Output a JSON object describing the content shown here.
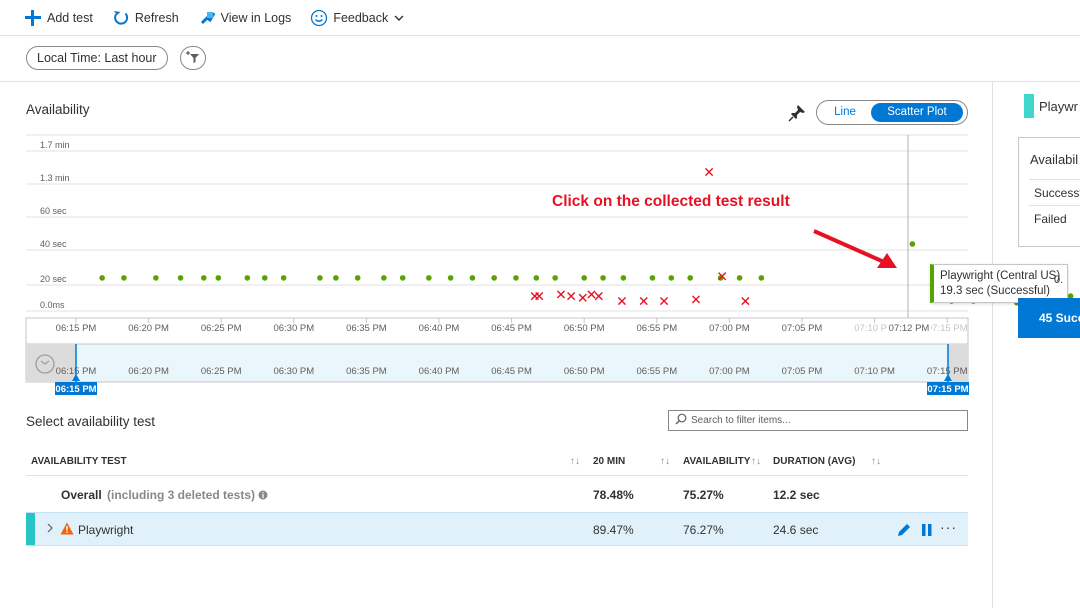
{
  "toolbar": {
    "add_test": "Add test",
    "refresh": "Refresh",
    "view_in_logs": "View in Logs",
    "feedback": "Feedback"
  },
  "filter": {
    "time_range": "Local Time: Last hour"
  },
  "chart_panel": {
    "title": "Availability",
    "toggle_line": "Line",
    "toggle_scatter": "Scatter Plot",
    "annotation": "Click on the collected test result"
  },
  "chart_data": {
    "type": "scatter",
    "title": "Availability",
    "xlabel": "",
    "ylabel": "",
    "x_ticks": [
      "06:15 PM",
      "06:20 PM",
      "06:25 PM",
      "06:30 PM",
      "06:35 PM",
      "06:40 PM",
      "06:45 PM",
      "06:50 PM",
      "06:55 PM",
      "07:00 PM",
      "07:05 PM",
      "07:10 PM",
      "07:15 PM"
    ],
    "y_ticks": [
      "0.0ms",
      "20 sec",
      "40 sec",
      "60 sec",
      "1.3 min",
      "1.7 min"
    ],
    "y_tick_values": [
      0,
      20,
      40,
      60,
      80,
      100
    ],
    "x_range_minutes": [
      0,
      60
    ],
    "ylim": [
      0,
      100
    ],
    "hover_time_label": "07:12 PM",
    "series": [
      {
        "name": "Successful",
        "color": "#57a300",
        "marker": "dot",
        "x": [
          1.8,
          3.3,
          5.5,
          7.2,
          8.8,
          9.8,
          11.8,
          13.0,
          14.3,
          16.8,
          17.9,
          19.4,
          21.2,
          22.5,
          24.3,
          25.8,
          27.3,
          28.8,
          30.3,
          31.7,
          33.0,
          35.0,
          36.3,
          37.7,
          39.7,
          41.0,
          42.3,
          44.4,
          45.7,
          47.2,
          57.6,
          59.1,
          60.3,
          61.8,
          63.5,
          64.8,
          66.1,
          67.2,
          68.5,
          70.0,
          71.3,
          72.6,
          74.0,
          75.2,
          76.4,
          78.5
        ],
        "y": [
          20,
          20,
          20,
          20,
          20,
          20,
          20,
          20,
          20,
          20,
          20,
          20,
          20,
          20,
          20,
          20,
          20,
          20,
          20,
          20,
          20,
          20,
          20,
          20,
          20,
          20,
          20,
          20,
          20,
          20,
          40.5,
          19.5,
          6,
          6,
          9,
          5,
          7,
          8,
          9,
          9,
          8,
          7,
          9,
          12,
          10,
          19.3
        ]
      },
      {
        "name": "Failed",
        "color": "#e81123",
        "marker": "x",
        "x": [
          31.6,
          31.9,
          33.4,
          34.1,
          34.9,
          35.5,
          36.0,
          37.6,
          39.1,
          40.5,
          42.7,
          43.6,
          44.5,
          46.1
        ],
        "y": [
          9,
          9,
          10,
          9,
          8,
          10,
          9,
          6,
          6,
          6,
          7,
          84,
          21,
          6
        ]
      }
    ],
    "range_selector": {
      "start_label": "06:15 PM",
      "end_label": "07:15 PM"
    }
  },
  "test_list": {
    "title": "Select availability test",
    "search_placeholder": "Search to filter items...",
    "columns": [
      "AVAILABILITY TEST",
      "20 MIN",
      "AVAILABILITY",
      "DURATION (AVG)"
    ],
    "overall": {
      "label": "Overall",
      "note": "(including 3 deleted tests)",
      "min20": "78.48%",
      "availability": "75.27%",
      "duration": "12.2 sec"
    },
    "rows": [
      {
        "name": "Playwright",
        "min20": "89.47%",
        "availability": "76.27%",
        "duration": "24.6 sec"
      }
    ]
  },
  "tooltip": {
    "line1": "Playwright (Central US)",
    "line2": "19.3 sec (Successful)"
  },
  "right_panel": {
    "title": "Playwr",
    "card_title": "Availabil",
    "row1": "Successf",
    "row2": "Failed",
    "obs": "0.",
    "blue_button": "45 Succ"
  },
  "colors": {
    "accent": "#0078d4",
    "success": "#57a300",
    "failure": "#e81123",
    "row_highlight": "#e0f1fb",
    "test_accent": "#25c5c5"
  }
}
